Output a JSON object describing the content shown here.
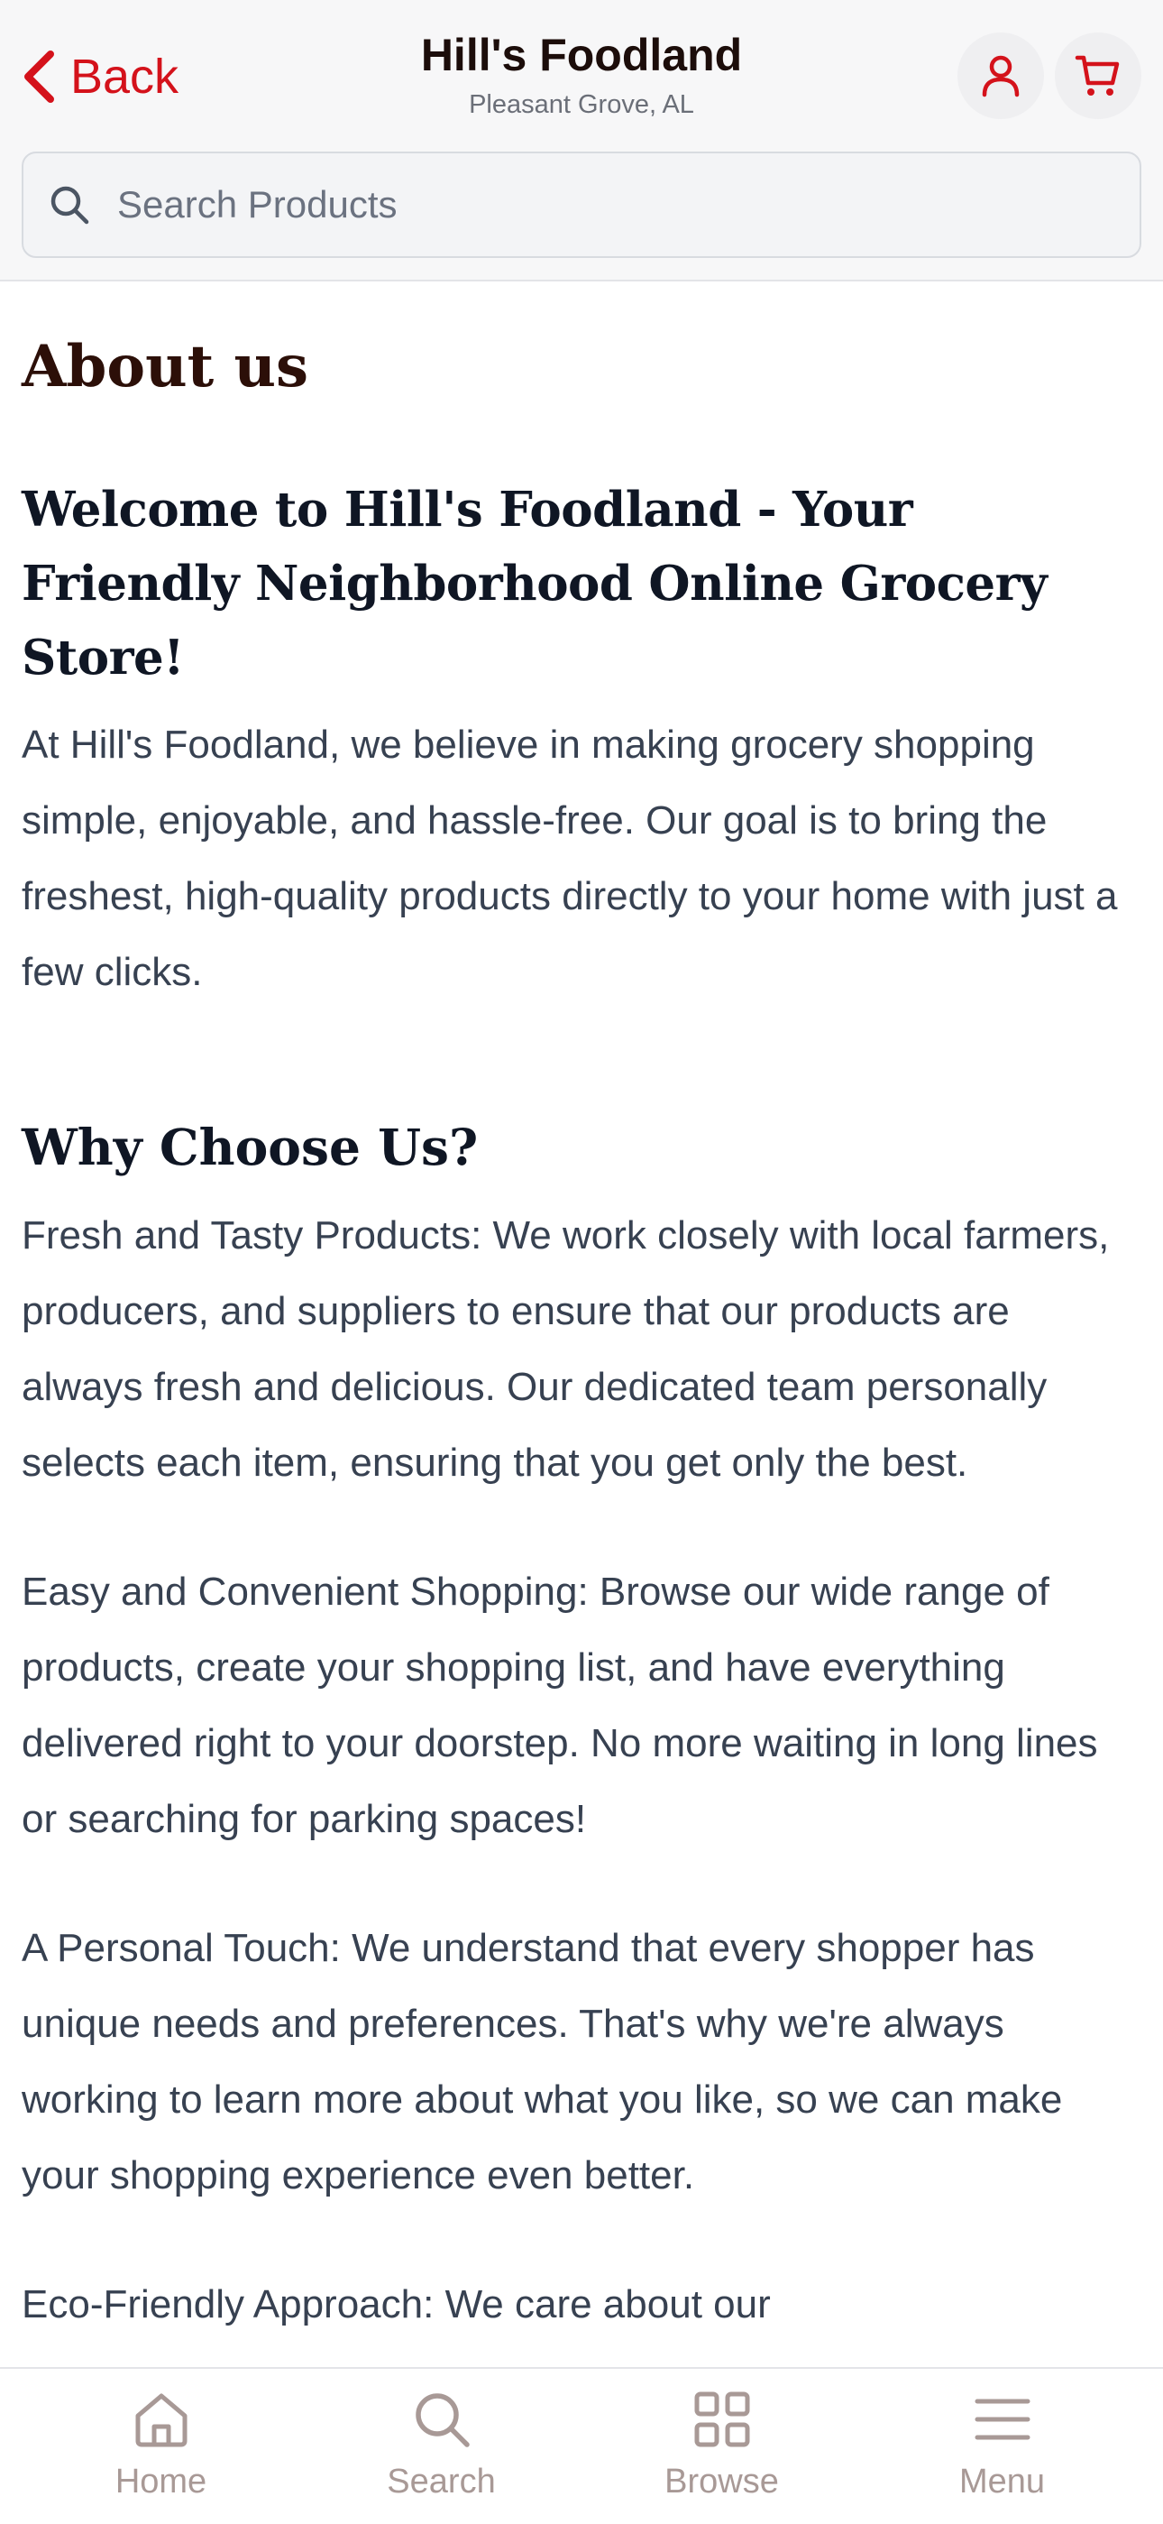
{
  "header": {
    "back_label": "Back",
    "store_name": "Hill's Foodland",
    "store_location": "Pleasant Grove, AL",
    "account_icon": "user-icon",
    "cart_icon": "cart-icon"
  },
  "search": {
    "placeholder": "Search Products",
    "value": ""
  },
  "main": {
    "title": "About us",
    "welcome_heading": "Welcome to Hill's Foodland - Your Friendly Neighborhood Online Grocery Store!",
    "intro": "At Hill's Foodland, we believe in making grocery shopping simple, enjoyable, and hassle-free. Our goal is to bring the freshest, high-quality products directly to your home with just a few clicks.",
    "why_heading": "Why Choose Us?",
    "paragraphs": [
      "Fresh and Tasty Products: We work closely with local farmers, producers, and suppliers to ensure that our products are always fresh and delicious. Our dedicated team personally selects each item, ensuring that you get only the best.",
      "Easy and Convenient Shopping: Browse our wide range of products, create your shopping list, and have everything delivered right to your doorstep. No more waiting in long lines or searching for parking spaces!",
      "A Personal Touch: We understand that every shopper has unique needs and preferences. That's why we're always working to learn more about what you like, so we can make your shopping experience even better.",
      "Eco-Friendly Approach: We care about our"
    ]
  },
  "bottom_nav": {
    "items": [
      {
        "label": "Home",
        "icon": "home-icon"
      },
      {
        "label": "Search",
        "icon": "search-icon"
      },
      {
        "label": "Browse",
        "icon": "grid-icon"
      },
      {
        "label": "Menu",
        "icon": "menu-icon"
      }
    ]
  },
  "colors": {
    "accent": "#d4121b",
    "title": "#2c0f08",
    "body_text": "#374151",
    "nav_inactive": "#a89996"
  }
}
